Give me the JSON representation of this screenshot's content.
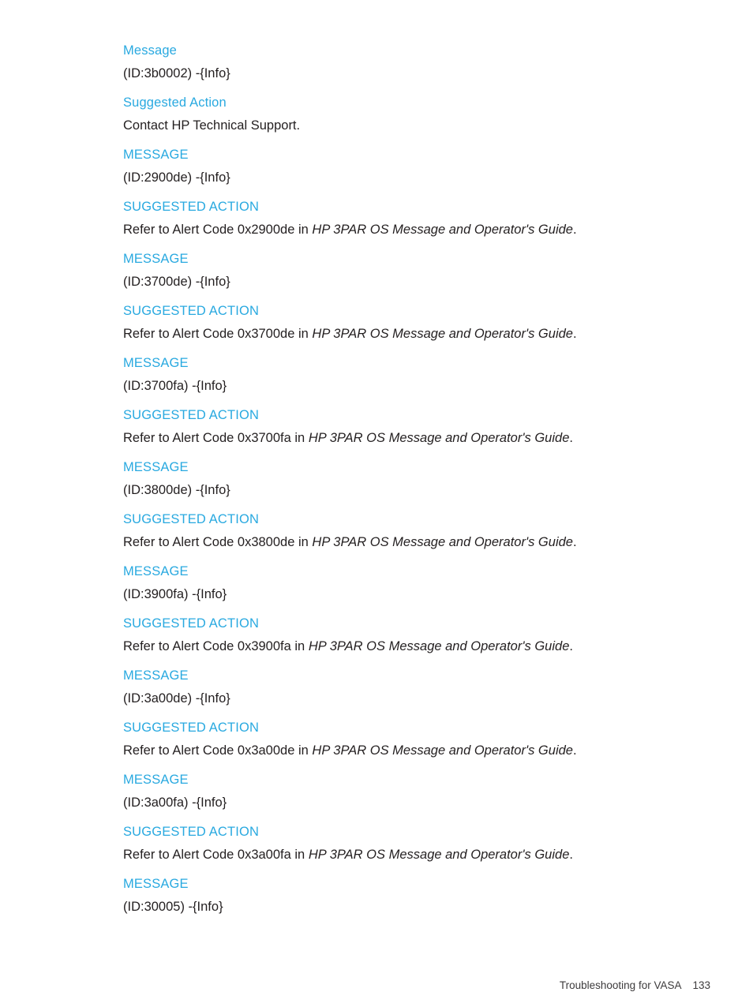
{
  "page": {
    "background_color": "#ffffff",
    "heading_color": "#29a9e0",
    "body_color": "#231f20"
  },
  "entries": [
    {
      "heading": "Message",
      "body_prefix": "(ID:3b0002) -{Info}",
      "body_italic": "",
      "body_suffix": ""
    },
    {
      "heading": "Suggested Action",
      "body_prefix": "Contact HP Technical Support.",
      "body_italic": "",
      "body_suffix": ""
    },
    {
      "heading": "MESSAGE",
      "body_prefix": "(ID:2900de) -{Info}",
      "body_italic": "",
      "body_suffix": ""
    },
    {
      "heading": "SUGGESTED ACTION",
      "body_prefix": "Refer to Alert Code 0x2900de in ",
      "body_italic": "HP 3PAR OS Message and Operator's Guide",
      "body_suffix": "."
    },
    {
      "heading": "MESSAGE",
      "body_prefix": "(ID:3700de) -{Info}",
      "body_italic": "",
      "body_suffix": ""
    },
    {
      "heading": "SUGGESTED ACTION",
      "body_prefix": "Refer to Alert Code 0x3700de in ",
      "body_italic": "HP 3PAR OS Message and Operator's Guide",
      "body_suffix": "."
    },
    {
      "heading": "MESSAGE",
      "body_prefix": "(ID:3700fa) -{Info}",
      "body_italic": "",
      "body_suffix": ""
    },
    {
      "heading": "SUGGESTED ACTION",
      "body_prefix": "Refer to Alert Code 0x3700fa in ",
      "body_italic": "HP 3PAR OS Message and Operator's Guide",
      "body_suffix": "."
    },
    {
      "heading": "MESSAGE",
      "body_prefix": "(ID:3800de) -{Info}",
      "body_italic": "",
      "body_suffix": ""
    },
    {
      "heading": "SUGGESTED ACTION",
      "body_prefix": "Refer to Alert Code 0x3800de in ",
      "body_italic": "HP 3PAR OS Message and Operator's Guide",
      "body_suffix": "."
    },
    {
      "heading": "MESSAGE",
      "body_prefix": "(ID:3900fa) -{Info}",
      "body_italic": "",
      "body_suffix": ""
    },
    {
      "heading": "SUGGESTED ACTION",
      "body_prefix": "Refer to Alert Code 0x3900fa in ",
      "body_italic": "HP 3PAR OS Message and Operator's Guide",
      "body_suffix": "."
    },
    {
      "heading": "MESSAGE",
      "body_prefix": "(ID:3a00de) -{Info}",
      "body_italic": "",
      "body_suffix": ""
    },
    {
      "heading": "SUGGESTED ACTION",
      "body_prefix": "Refer to Alert Code 0x3a00de in ",
      "body_italic": "HP 3PAR OS Message and Operator's Guide",
      "body_suffix": "."
    },
    {
      "heading": "MESSAGE",
      "body_prefix": "(ID:3a00fa) -{Info}",
      "body_italic": "",
      "body_suffix": ""
    },
    {
      "heading": "SUGGESTED ACTION",
      "body_prefix": "Refer to Alert Code 0x3a00fa in ",
      "body_italic": "HP 3PAR OS Message and Operator's Guide",
      "body_suffix": "."
    },
    {
      "heading": "MESSAGE",
      "body_prefix": "(ID:30005) -{Info}",
      "body_italic": "",
      "body_suffix": ""
    }
  ],
  "footer": {
    "title": "Troubleshooting for VASA",
    "page_number": "133"
  }
}
